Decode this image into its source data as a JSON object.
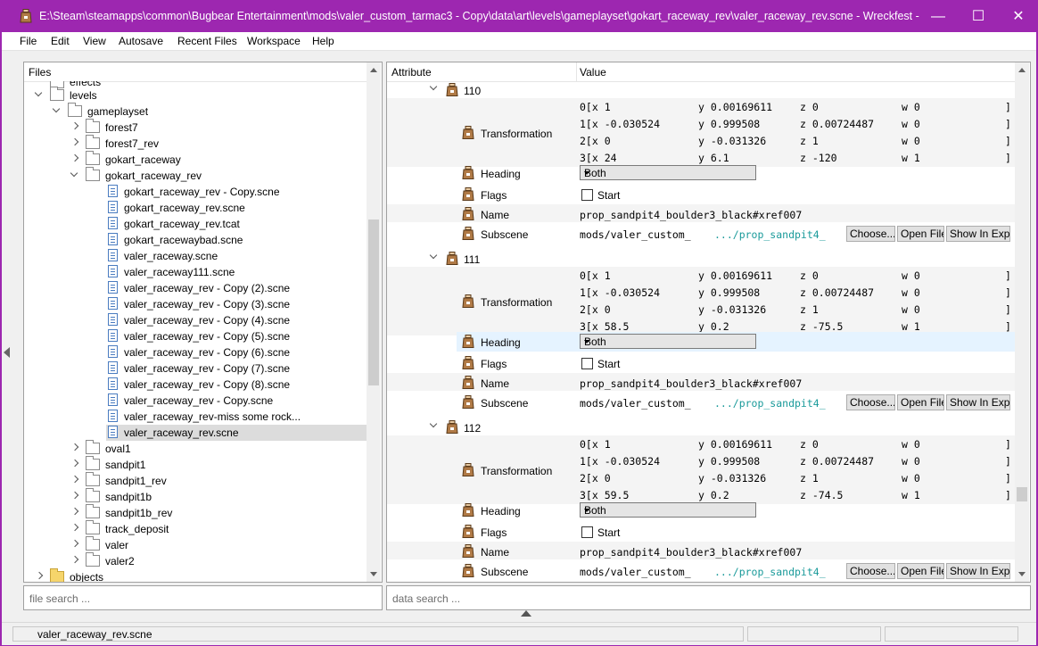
{
  "window": {
    "title": "E:\\Steam\\steamapps\\common\\Bugbear Entertainment\\mods\\valer_custom_tarmac3 - Copy\\data\\art\\levels\\gameplayset\\gokart_raceway_rev\\valer_raceway_rev.scne - Wreckfest - Bag ...",
    "minimize": "—",
    "maximize": "☐",
    "close": "✕"
  },
  "menu": [
    "File",
    "Edit",
    "View",
    "Autosave",
    "Recent Files",
    "Workspace",
    "Help"
  ],
  "files_panel": {
    "header": "Files",
    "search_placeholder": "file search ...",
    "tree": [
      {
        "label": "effects",
        "type": "folder",
        "state": "none"
      },
      {
        "label": "levels",
        "type": "folder",
        "state": "open"
      },
      {
        "label": "gameplayset",
        "type": "folder",
        "state": "open"
      },
      {
        "label": "forest7",
        "type": "folder",
        "state": "closed"
      },
      {
        "label": "forest7_rev",
        "type": "folder",
        "state": "closed"
      },
      {
        "label": "gokart_raceway",
        "type": "folder",
        "state": "closed"
      },
      {
        "label": "gokart_raceway_rev",
        "type": "folder",
        "state": "open"
      },
      {
        "label": "gokart_raceway_rev - Copy.scne",
        "type": "file"
      },
      {
        "label": "gokart_raceway_rev.scne",
        "type": "file"
      },
      {
        "label": "gokart_raceway_rev.tcat",
        "type": "file"
      },
      {
        "label": "gokart_racewaybad.scne",
        "type": "file"
      },
      {
        "label": "valer_raceway.scne",
        "type": "file"
      },
      {
        "label": "valer_raceway111.scne",
        "type": "file"
      },
      {
        "label": "valer_raceway_rev - Copy (2).scne",
        "type": "file"
      },
      {
        "label": "valer_raceway_rev - Copy (3).scne",
        "type": "file"
      },
      {
        "label": "valer_raceway_rev - Copy (4).scne",
        "type": "file"
      },
      {
        "label": "valer_raceway_rev - Copy (5).scne",
        "type": "file"
      },
      {
        "label": "valer_raceway_rev - Copy (6).scne",
        "type": "file"
      },
      {
        "label": "valer_raceway_rev - Copy (7).scne",
        "type": "file"
      },
      {
        "label": "valer_raceway_rev - Copy (8).scne",
        "type": "file"
      },
      {
        "label": "valer_raceway_rev - Copy.scne",
        "type": "file"
      },
      {
        "label": "valer_raceway_rev-miss some rock...",
        "type": "file"
      },
      {
        "label": "valer_raceway_rev.scne",
        "type": "file",
        "selected": true
      },
      {
        "label": "oval1",
        "type": "folder",
        "state": "closed"
      },
      {
        "label": "sandpit1",
        "type": "folder",
        "state": "closed"
      },
      {
        "label": "sandpit1_rev",
        "type": "folder",
        "state": "closed"
      },
      {
        "label": "sandpit1b",
        "type": "folder",
        "state": "closed"
      },
      {
        "label": "sandpit1b_rev",
        "type": "folder",
        "state": "closed"
      },
      {
        "label": "track_deposit",
        "type": "folder",
        "state": "closed"
      },
      {
        "label": "valer",
        "type": "folder",
        "state": "closed"
      },
      {
        "label": "valer2",
        "type": "folder",
        "state": "closed"
      },
      {
        "label": "objects",
        "type": "folder",
        "state": "closed",
        "color": "yellow"
      }
    ]
  },
  "attr_panel": {
    "header_attribute": "Attribute",
    "header_value": "Value",
    "search_placeholder": "data search ...",
    "entries": [
      {
        "id": "110",
        "transformation": [
          [
            "0[x 1",
            "y 0.00169611",
            "z 0",
            "w 0",
            "]"
          ],
          [
            "1[x -0.030524",
            "y 0.999508",
            "z 0.00724487",
            "w 0",
            "]"
          ],
          [
            "2[x 0",
            "y -0.031326",
            "z 1",
            "w 0",
            "]"
          ],
          [
            "3[x 24",
            "y 6.1",
            "z -120",
            "w 1",
            "]"
          ]
        ],
        "heading": "Both",
        "flags_label": "Start",
        "name": "prop_sandpit4_boulder3_black#xref007",
        "subscene_prefix": "mods/valer_custom_",
        "subscene_suffix": ".../prop_sandpit4_"
      },
      {
        "id": "111",
        "transformation": [
          [
            "0[x 1",
            "y 0.00169611",
            "z 0",
            "w 0",
            "]"
          ],
          [
            "1[x -0.030524",
            "y 0.999508",
            "z 0.00724487",
            "w 0",
            "]"
          ],
          [
            "2[x 0",
            "y -0.031326",
            "z 1",
            "w 0",
            "]"
          ],
          [
            "3[x 58.5",
            "y 0.2",
            "z -75.5",
            "w 1",
            "]"
          ]
        ],
        "heading": "Both",
        "flags_label": "Start",
        "name": "prop_sandpit4_boulder3_black#xref007",
        "subscene_prefix": "mods/valer_custom_",
        "subscene_suffix": ".../prop_sandpit4_"
      },
      {
        "id": "112",
        "transformation": [
          [
            "0[x 1",
            "y 0.00169611",
            "z 0",
            "w 0",
            "]"
          ],
          [
            "1[x -0.030524",
            "y 0.999508",
            "z 0.00724487",
            "w 0",
            "]"
          ],
          [
            "2[x 0",
            "y -0.031326",
            "z 1",
            "w 0",
            "]"
          ],
          [
            "3[x 59.5",
            "y 0.2",
            "z -74.5",
            "w 1",
            "]"
          ]
        ],
        "heading": "Both",
        "flags_label": "Start",
        "name": "prop_sandpit4_boulder3_black#xref007",
        "subscene_prefix": "mods/valer_custom_",
        "subscene_suffix": ".../prop_sandpit4_"
      }
    ],
    "labels": {
      "transformation": "Transformation",
      "heading": "Heading",
      "flags": "Flags",
      "name": "Name",
      "subscene": "Subscene"
    },
    "buttons": {
      "choose": "Choose...",
      "open_file": "Open File",
      "show_in_explorer": "Show In Explorer"
    }
  },
  "status": {
    "filename": "valer_raceway_rev.scne"
  },
  "colors": {
    "titlebar": "#9d27b0",
    "subscene_link": "#1a9a9a",
    "bag_icon": "#8b5a2b"
  }
}
